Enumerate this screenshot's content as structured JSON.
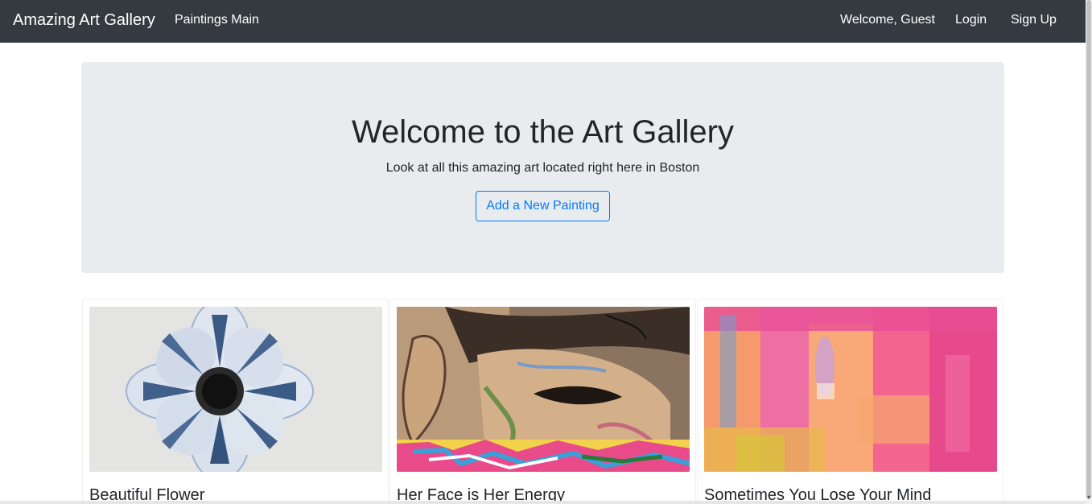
{
  "navbar": {
    "brand": "Amazing Art Gallery",
    "main_link": "Paintings Main",
    "welcome": "Welcome, Guest",
    "login": "Login",
    "signup": "Sign Up"
  },
  "jumbotron": {
    "title": "Welcome to the Art Gallery",
    "subtitle": "Look at all this amazing art located right here in Boston",
    "button": "Add a New Painting"
  },
  "paintings": [
    {
      "title": "Beautiful Flower",
      "image": "blue-white-flower"
    },
    {
      "title": "Her Face is Her Energy",
      "image": "graffiti-face"
    },
    {
      "title": "Sometimes You Lose Your Mind",
      "image": "pink-orange-abstract"
    }
  ],
  "colors": {
    "navbar_bg": "#343a40",
    "jumbotron_bg": "#e9ecef",
    "primary": "#007bff"
  }
}
